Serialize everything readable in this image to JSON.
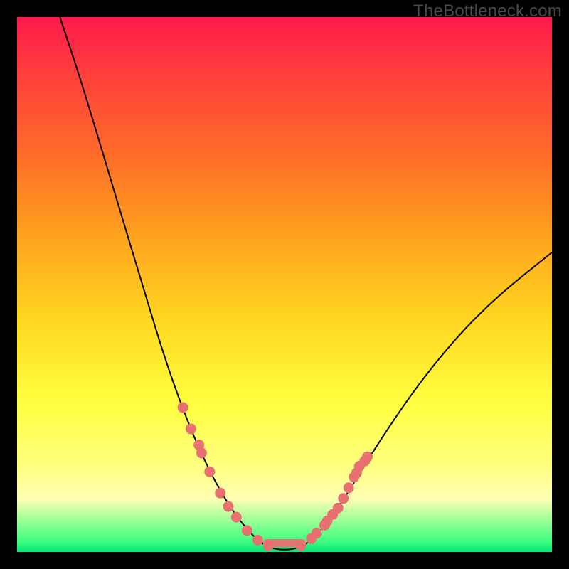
{
  "watermark": "TheBottleneck.com",
  "colors": {
    "dot": "#e87070",
    "curve": "#000000",
    "gradient_top": "#ff1a4d",
    "gradient_bottom": "#00e676"
  },
  "chart_data": {
    "type": "line",
    "title": "",
    "xlabel": "",
    "ylabel": "",
    "xlim": [
      0,
      100
    ],
    "ylim": [
      0,
      100
    ],
    "curve": [
      {
        "x": 8,
        "y": 100
      },
      {
        "x": 12,
        "y": 88
      },
      {
        "x": 18,
        "y": 68
      },
      {
        "x": 24,
        "y": 48
      },
      {
        "x": 28,
        "y": 35
      },
      {
        "x": 32,
        "y": 24
      },
      {
        "x": 36,
        "y": 15
      },
      {
        "x": 40,
        "y": 8
      },
      {
        "x": 44,
        "y": 3
      },
      {
        "x": 47,
        "y": 0.8
      },
      {
        "x": 50,
        "y": 0.3
      },
      {
        "x": 53,
        "y": 0.8
      },
      {
        "x": 56,
        "y": 3
      },
      {
        "x": 60,
        "y": 8
      },
      {
        "x": 66,
        "y": 18
      },
      {
        "x": 74,
        "y": 30
      },
      {
        "x": 82,
        "y": 40
      },
      {
        "x": 90,
        "y": 48
      },
      {
        "x": 100,
        "y": 56
      }
    ],
    "points": [
      {
        "x": 31,
        "y": 27
      },
      {
        "x": 32.5,
        "y": 23
      },
      {
        "x": 34,
        "y": 20
      },
      {
        "x": 34.5,
        "y": 18.5
      },
      {
        "x": 36,
        "y": 15
      },
      {
        "x": 38,
        "y": 11
      },
      {
        "x": 39.5,
        "y": 8.5
      },
      {
        "x": 41,
        "y": 6.5
      },
      {
        "x": 43,
        "y": 4
      },
      {
        "x": 45,
        "y": 2.2
      },
      {
        "x": 47,
        "y": 1.2
      },
      {
        "x": 53,
        "y": 1.2
      },
      {
        "x": 55,
        "y": 2.5
      },
      {
        "x": 56,
        "y": 3.5
      },
      {
        "x": 57.5,
        "y": 5
      },
      {
        "x": 58,
        "y": 5.8
      },
      {
        "x": 59,
        "y": 7
      },
      {
        "x": 60,
        "y": 8.2
      },
      {
        "x": 61,
        "y": 10
      },
      {
        "x": 62,
        "y": 12
      },
      {
        "x": 63,
        "y": 14
      },
      {
        "x": 63.5,
        "y": 14.8
      },
      {
        "x": 64,
        "y": 16
      },
      {
        "x": 65,
        "y": 17
      },
      {
        "x": 65.5,
        "y": 17.8
      }
    ],
    "flat_band": {
      "x0": 46,
      "x1": 54,
      "y": 0.9,
      "h": 1.5
    }
  }
}
